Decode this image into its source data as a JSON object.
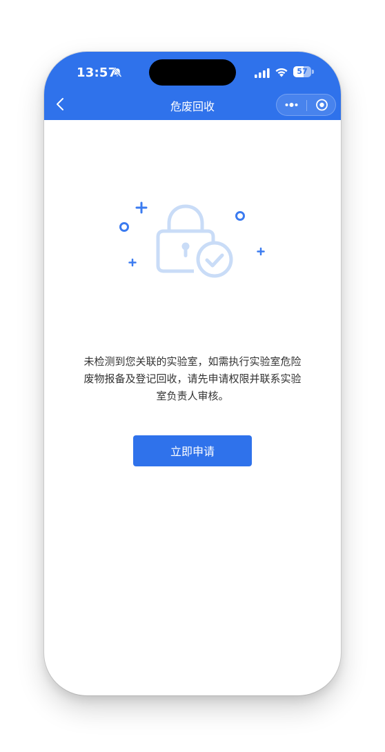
{
  "status_bar": {
    "time": "13:57",
    "battery_level": "57",
    "icons": [
      "bell-slash-icon",
      "signal-icon",
      "wifi-icon",
      "battery-icon"
    ]
  },
  "nav": {
    "title": "危废回收",
    "back_icon": "chevron-left-icon",
    "more_icon": "more-dots-icon",
    "close_icon": "target-close-icon"
  },
  "empty_state": {
    "illustration_icon": "lock-check-icon",
    "message": "未检测到您关联的实验室，如需执行实验室危险废物报备及登记回收，请先申请权限并联系实验室负责人审核。"
  },
  "actions": {
    "apply_label": "立即申请"
  },
  "colors": {
    "primary": "#2f72eb",
    "illustration": "#c9dcf7",
    "accent": "#3b7bf0",
    "text": "#333333"
  }
}
